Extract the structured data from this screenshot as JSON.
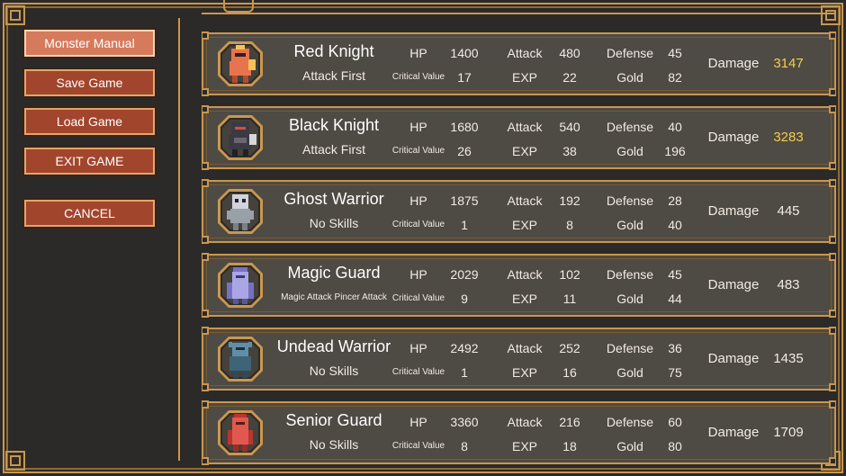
{
  "menu": {
    "items": [
      {
        "label": "Monster Manual",
        "active": true
      },
      {
        "label": "Save Game",
        "active": false
      },
      {
        "label": "Load Game",
        "active": false
      },
      {
        "label": "EXIT GAME",
        "active": false
      },
      {
        "label": "CANCEL",
        "active": false
      }
    ]
  },
  "labels": {
    "hp": "HP",
    "attack": "Attack",
    "defense": "Defense",
    "critical": "Critical Value",
    "exp": "EXP",
    "gold": "Gold",
    "damage": "Damage"
  },
  "monsters": [
    {
      "name": "Red Knight",
      "skill": "Attack First",
      "hp": "1400",
      "attack": "480",
      "defense": "45",
      "critical": "17",
      "exp": "22",
      "gold": "82",
      "damage": "3147",
      "damage_highlight": true,
      "icon": "red-knight-icon",
      "color": "#e8734f"
    },
    {
      "name": "Black Knight",
      "skill": "Attack First",
      "hp": "1680",
      "attack": "540",
      "defense": "40",
      "critical": "26",
      "exp": "38",
      "gold": "196",
      "damage": "3283",
      "damage_highlight": true,
      "icon": "black-knight-icon",
      "color": "#3b3a44"
    },
    {
      "name": "Ghost Warrior",
      "skill": "No Skills",
      "hp": "1875",
      "attack": "192",
      "defense": "28",
      "critical": "1",
      "exp": "8",
      "gold": "40",
      "damage": "445",
      "damage_highlight": false,
      "icon": "ghost-warrior-icon",
      "color": "#cfd3da"
    },
    {
      "name": "Magic Guard",
      "skill": "Magic Attack Pincer Attack",
      "hp": "2029",
      "attack": "102",
      "defense": "45",
      "critical": "9",
      "exp": "11",
      "gold": "44",
      "damage": "483",
      "damage_highlight": false,
      "icon": "magic-guard-icon",
      "color": "#a9a6e6"
    },
    {
      "name": "Undead Warrior",
      "skill": "No Skills",
      "hp": "2492",
      "attack": "252",
      "defense": "36",
      "critical": "1",
      "exp": "16",
      "gold": "75",
      "damage": "1435",
      "damage_highlight": false,
      "icon": "undead-warrior-icon",
      "color": "#5f8fa8"
    },
    {
      "name": "Senior Guard",
      "skill": "No Skills",
      "hp": "3360",
      "attack": "216",
      "defense": "60",
      "critical": "8",
      "exp": "18",
      "gold": "80",
      "damage": "1709",
      "damage_highlight": false,
      "icon": "senior-guard-icon",
      "color": "#e0584f"
    }
  ],
  "colors": {
    "border_gold": "#c9974f",
    "row_bg": "#4e4a44",
    "button_red": "#a2452d",
    "damage_highlight": "#f2cf4e"
  }
}
